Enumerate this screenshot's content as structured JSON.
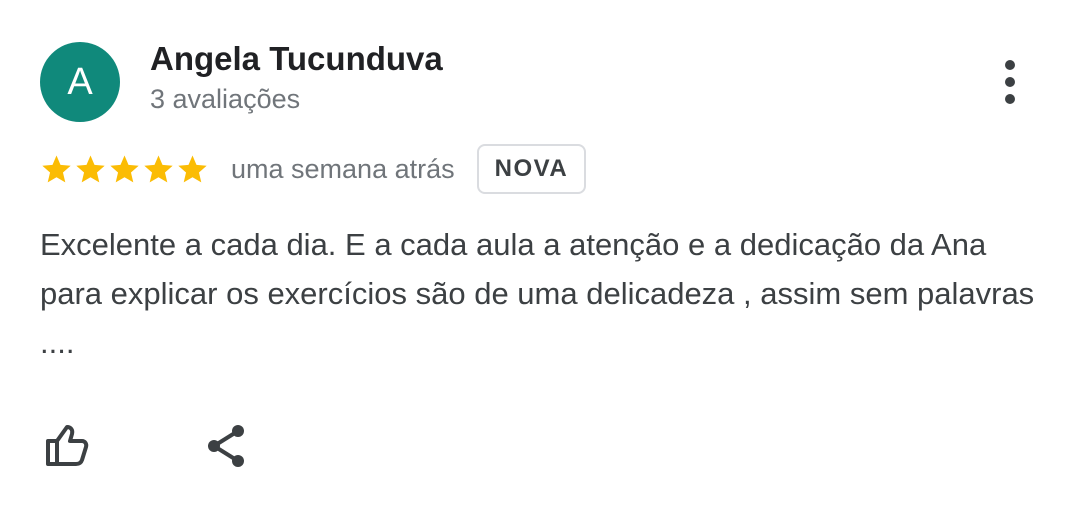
{
  "author": {
    "initial": "A",
    "name": "Angela Tucunduva",
    "review_count": "3 avaliações",
    "avatar_color": "#10897b"
  },
  "rating": {
    "stars": 5,
    "max_stars": 5,
    "star_color": "#fbbc04",
    "time": "uma semana atrás",
    "badge": "NOVA"
  },
  "review": {
    "text": "Excelente a cada dia. E a cada aula a atenção e a dedicação da Ana para explicar os exercícios são de uma delicadeza , assim sem palavras ...."
  },
  "icons": {
    "more": "more-vert-icon",
    "like": "thumb-up-icon",
    "share": "share-icon",
    "star": "star-icon"
  }
}
